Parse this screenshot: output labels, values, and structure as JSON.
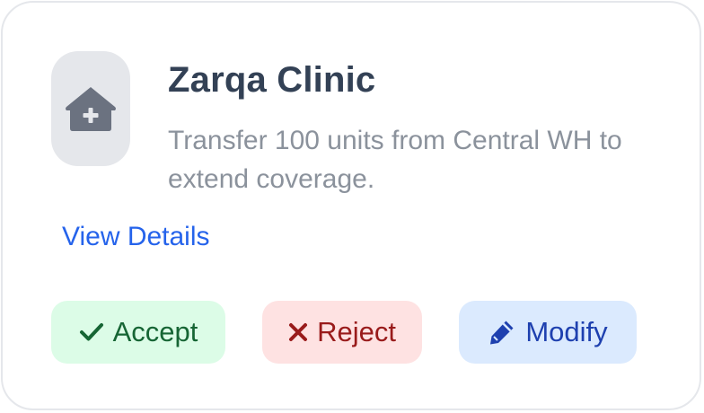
{
  "card": {
    "title": "Zarqa Clinic",
    "description": "Transfer 100 units from Central WH to extend coverage.",
    "details_link": "View Details",
    "icon": "clinic-house-medical-icon"
  },
  "actions": {
    "accept_label": "Accept",
    "reject_label": "Reject",
    "modify_label": "Modify"
  },
  "colors": {
    "title": "#334155",
    "description": "#8b929c",
    "link": "#2563eb",
    "accept_bg": "#dcfce7",
    "accept_fg": "#166534",
    "reject_bg": "#fee2e2",
    "reject_fg": "#991b1b",
    "modify_bg": "#dbeafe",
    "modify_fg": "#1e40af"
  }
}
